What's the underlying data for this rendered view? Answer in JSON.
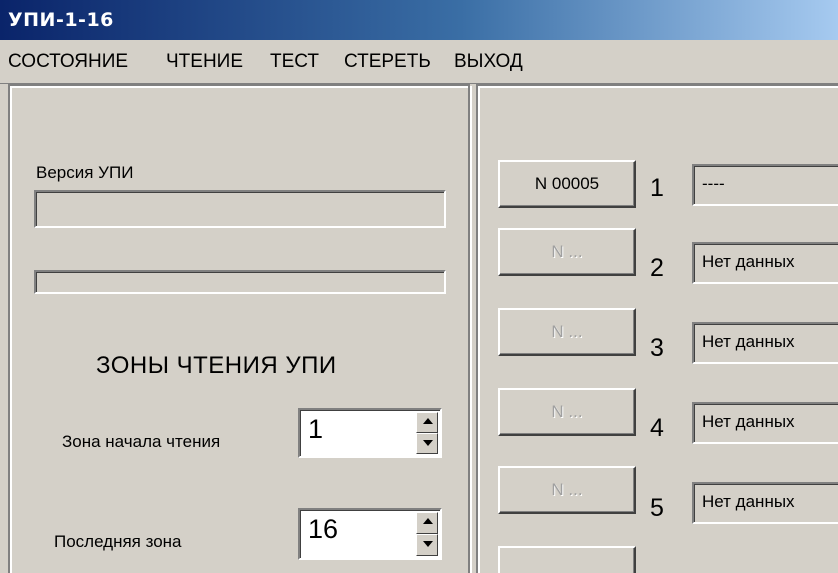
{
  "window": {
    "title": "УПИ-1-16"
  },
  "menu": {
    "items": [
      "СОСТОЯНИЕ",
      "ЧТЕНИЕ",
      "ТЕСТ",
      "СТЕРЕТЬ",
      "ВЫХОД"
    ]
  },
  "left_panel": {
    "version_label": "Версия  УПИ",
    "version_value": "",
    "progress_value": "",
    "zones_heading": "ЗОНЫ ЧТЕНИЯ УПИ",
    "start_zone_label": "Зона начала чтения",
    "start_zone_value": "1",
    "last_zone_label": "Последняя зона",
    "last_zone_value": "16"
  },
  "right_panel": {
    "rows": [
      {
        "button": "N 00005",
        "number": "1",
        "status": "----",
        "enabled": true
      },
      {
        "button": "N ...",
        "number": "2",
        "status": "Нет данных",
        "enabled": false
      },
      {
        "button": "N ...",
        "number": "3",
        "status": "Нет данных",
        "enabled": false
      },
      {
        "button": "N ...",
        "number": "4",
        "status": "Нет данных",
        "enabled": false
      },
      {
        "button": "N ...",
        "number": "5",
        "status": "Нет данных",
        "enabled": false
      }
    ]
  }
}
